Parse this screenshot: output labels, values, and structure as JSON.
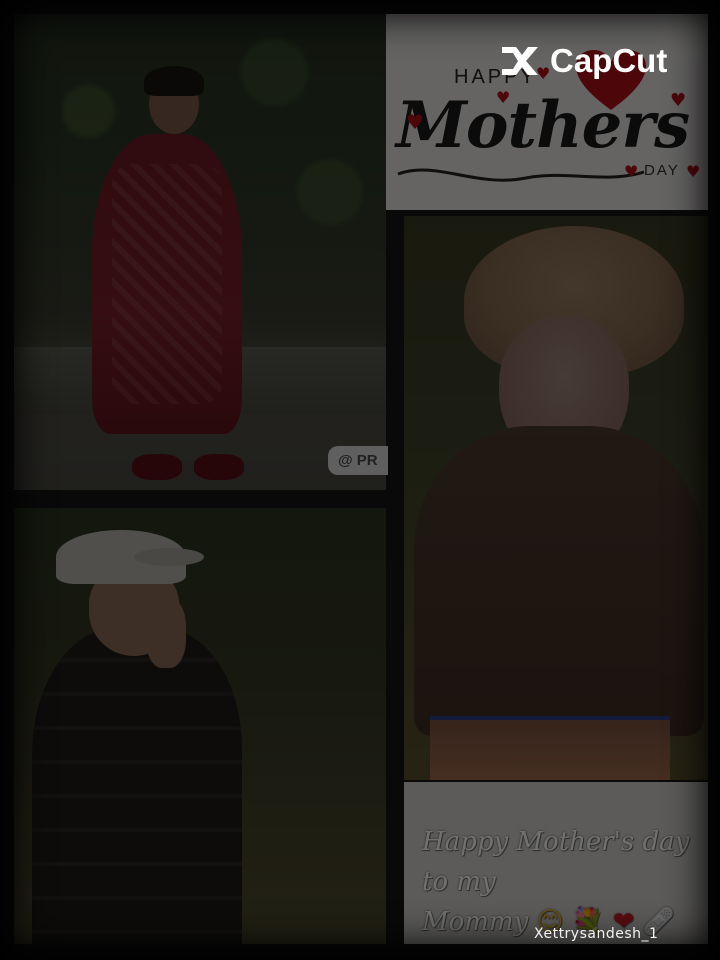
{
  "watermark": {
    "brand": "CapCut",
    "icon": "capcut-logo-icon"
  },
  "greeting_graphic": {
    "happy": "HAPPY",
    "mothers": "Mothers",
    "day": "DAY",
    "icon": "heart-icon",
    "accent_color": "#b0111b"
  },
  "tag_pill": {
    "text": "@ PR"
  },
  "caption": {
    "line1": "Happy Mother's day to my",
    "line2": "Mommy",
    "emojis": [
      "😊",
      "💐",
      "❤",
      "🩹"
    ]
  },
  "username": "Xettrysandesh_1"
}
